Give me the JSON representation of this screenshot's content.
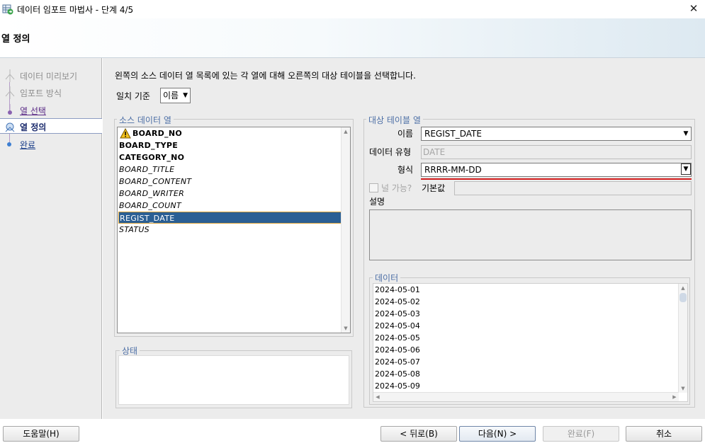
{
  "window": {
    "title": "데이터 임포트 마법사 - 단계 4/5",
    "close_glyph": "✕"
  },
  "banner": {
    "heading": "열 정의"
  },
  "steps": [
    {
      "label": "데이터 미리보기",
      "state": "done"
    },
    {
      "label": "임포트 방식",
      "state": "done"
    },
    {
      "label": "열 선택",
      "state": "visited"
    },
    {
      "label": "열 정의",
      "state": "current"
    },
    {
      "label": "완료",
      "state": "pending"
    }
  ],
  "main": {
    "instruction": "왼쪽의 소스 데이터 열 목록에 있는 각 열에 대해 오른쪽의 대상 테이블을 선택합니다.",
    "match_label": "일치 기준",
    "match_value": "이름"
  },
  "source": {
    "title": "소스 데이터 열",
    "columns": [
      {
        "name": "BOARD_NO",
        "style": "bold",
        "warning": true
      },
      {
        "name": "BOARD_TYPE",
        "style": "bold",
        "warning": false
      },
      {
        "name": "CATEGORY_NO",
        "style": "bold",
        "warning": false
      },
      {
        "name": "BOARD_TITLE",
        "style": "italic",
        "warning": false
      },
      {
        "name": "BOARD_CONTENT",
        "style": "italic",
        "warning": false
      },
      {
        "name": "BOARD_WRITER",
        "style": "italic",
        "warning": false
      },
      {
        "name": "BOARD_COUNT",
        "style": "italic",
        "warning": false
      },
      {
        "name": "REGIST_DATE",
        "style": "selected",
        "warning": false
      },
      {
        "name": "STATUS",
        "style": "italic",
        "warning": false
      }
    ]
  },
  "status": {
    "title": "상태"
  },
  "target": {
    "title": "대상 테이블 열",
    "name_label": "이름",
    "name_value": "REGIST_DATE",
    "type_label": "데이터 유형",
    "type_value": "DATE",
    "format_label": "형식",
    "format_value": "RRRR-MM-DD",
    "nullable_label": "널 가능?",
    "default_label": "기본값",
    "desc_label": "설명"
  },
  "data": {
    "title": "데이터",
    "rows": [
      "2024-05-01",
      "2024-05-02",
      "2024-05-03",
      "2024-05-04",
      "2024-05-05",
      "2024-05-06",
      "2024-05-07",
      "2024-05-08",
      "2024-05-09"
    ]
  },
  "footer": {
    "help": "도움말(H)",
    "back": "< 뒤로(B)",
    "next": "다음(N) >",
    "finish": "완료(F)",
    "cancel": "취소"
  },
  "colors": {
    "accent": "#2b5f94",
    "group_title": "#4d6fa6",
    "highlight": "#d31b1b"
  }
}
